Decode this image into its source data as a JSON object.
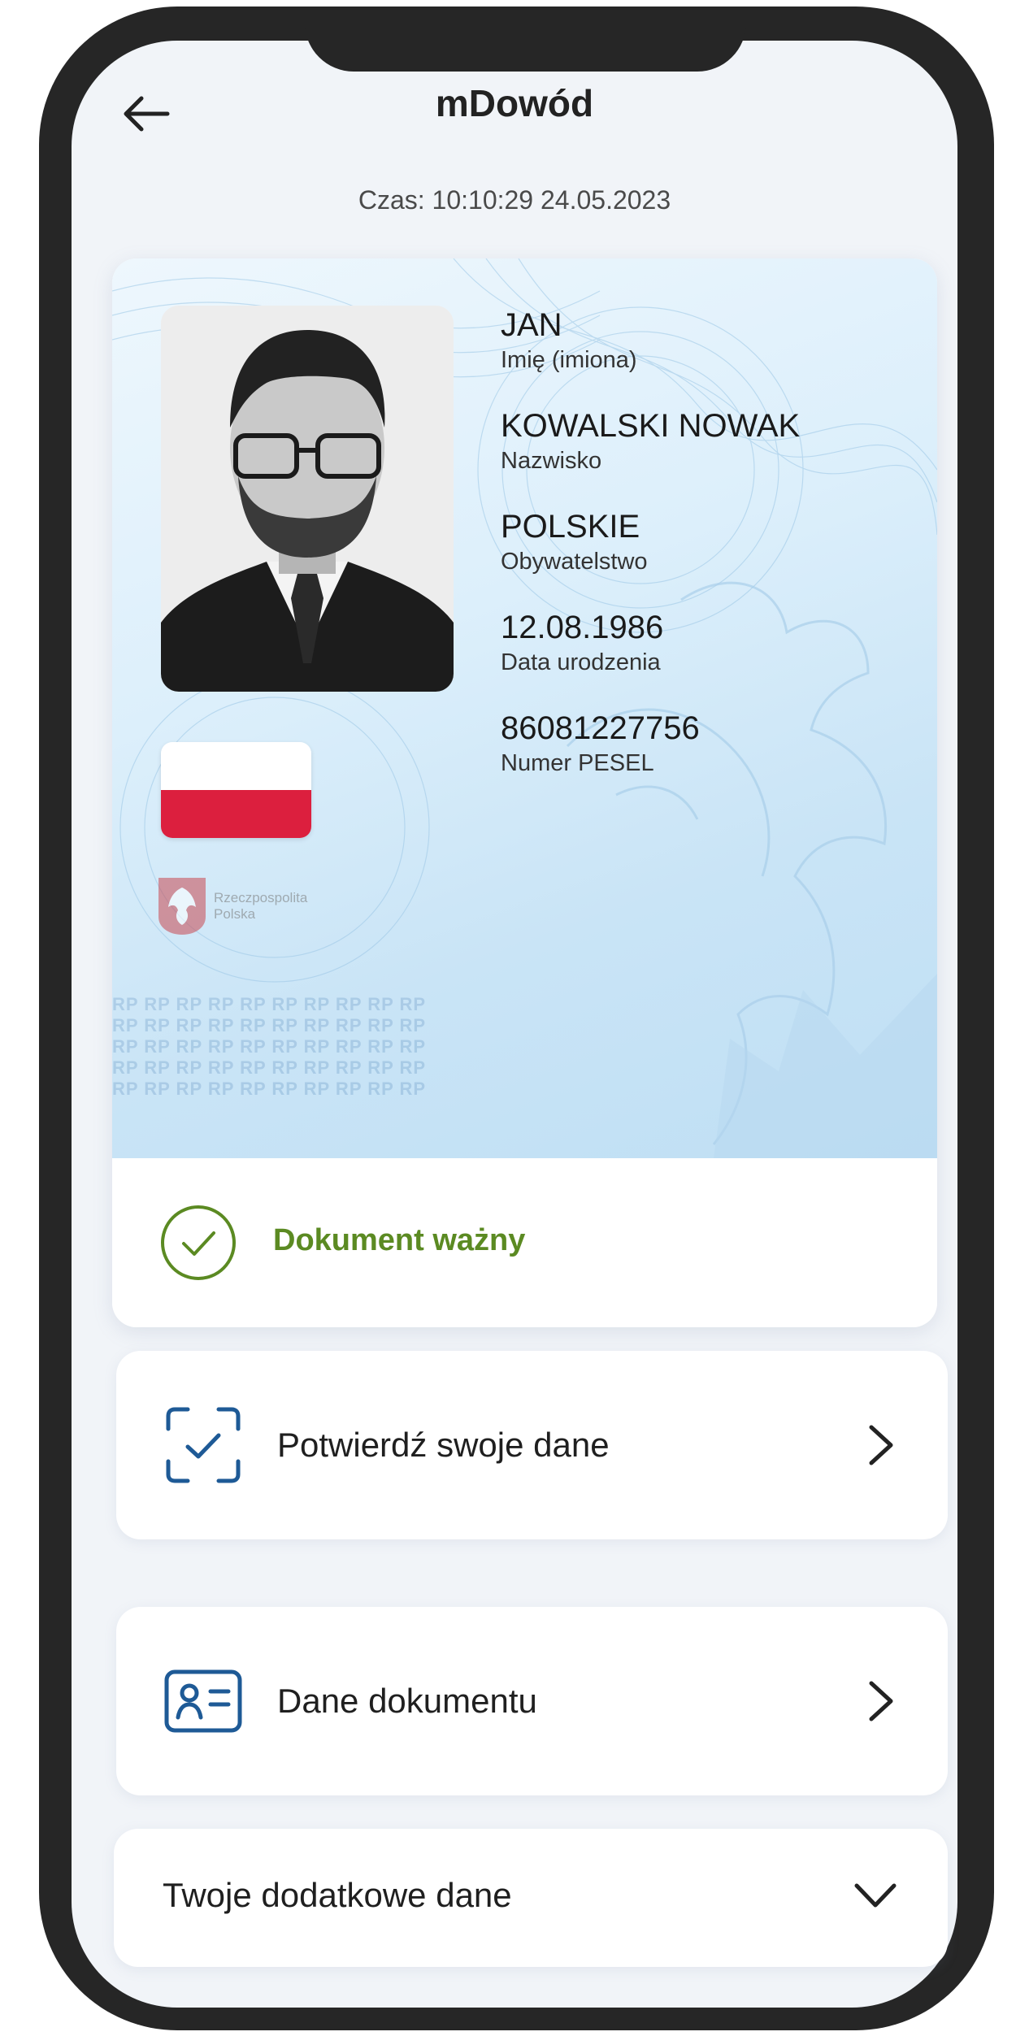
{
  "header": {
    "title": "mDowód",
    "timestamp": "Czas: 10:10:29 24.05.2023"
  },
  "card": {
    "fields": [
      {
        "value": "JAN",
        "label": "Imię (imiona)"
      },
      {
        "value": "KOWALSKI NOWAK",
        "label": "Nazwisko"
      },
      {
        "value": "POLSKIE",
        "label": "Obywatelstwo"
      },
      {
        "value": "12.08.1986",
        "label": "Data urodzenia"
      },
      {
        "value": "86081227756",
        "label": "Numer PESEL"
      }
    ],
    "emblem_text_line1": "Rzeczpospolita",
    "emblem_text_line2": "Polska",
    "watermark_text": "RP RP RP RP RP RP RP RP RP RP",
    "status": "Dokument ważny"
  },
  "menu": {
    "items": [
      {
        "label": "Potwierdź swoje dane",
        "icon": "scan-check-icon"
      },
      {
        "label": "Dane dokumentu",
        "icon": "id-card-icon"
      }
    ],
    "accordion_label": "Twoje dodatkowe dane"
  },
  "colors": {
    "accent_blue": "#1e5a96",
    "valid_green": "#5b8a22",
    "flag_red": "#dc1f3e",
    "background": "#f1f4f8"
  }
}
